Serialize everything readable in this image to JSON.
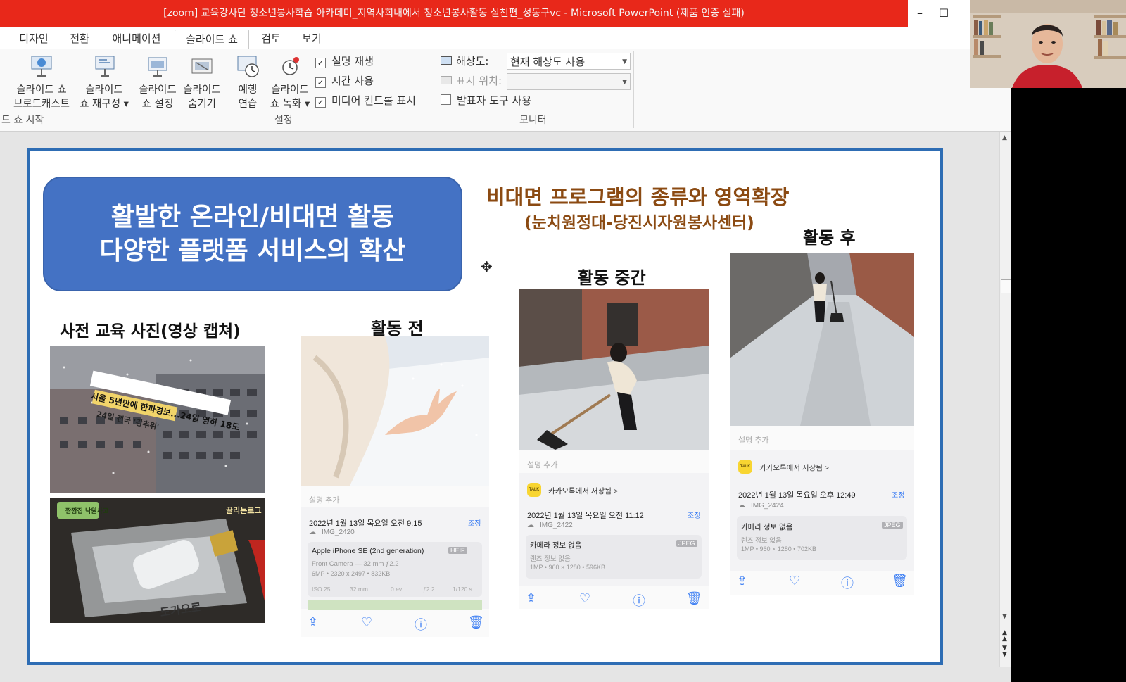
{
  "window": {
    "title": "[zoom] 교육강사단 청소년봉사학습 아카데미_지역사회내에서 청소년봉사활동 실천편_성동구vc  -  Microsoft PowerPoint (제품 인증 실패)",
    "minimize": "–",
    "maximize": "☐"
  },
  "tabs": [
    {
      "label": "디자인"
    },
    {
      "label": "전환"
    },
    {
      "label": "애니메이션"
    },
    {
      "label": "슬라이드 쇼"
    },
    {
      "label": "검토"
    },
    {
      "label": "보기"
    }
  ],
  "ribbon": {
    "broadcast": {
      "line1": "슬라이드 쇼",
      "line2": "브로드캐스트"
    },
    "reconfigure": {
      "line1": "슬라이드",
      "line2": "쇼 재구성"
    },
    "group_start": "드 쇼 시작",
    "setup": {
      "line1": "슬라이드",
      "line2": "쇼 설정"
    },
    "hide": {
      "line1": "슬라이드",
      "line2": "숨기기"
    },
    "rehearse": {
      "line1": "예행",
      "line2": "연습"
    },
    "record": {
      "line1": "슬라이드",
      "line2": "쇼 녹화"
    },
    "chk_narration": "설명 재생",
    "chk_timing": "시간 사용",
    "chk_media": "미디어 컨트롤 표시",
    "group_setup": "설정",
    "resolution_label": "해상도:",
    "resolution_value": "현재 해상도 사용",
    "show_on_label": "표시 위치:",
    "presenter_view": "발표자 도구 사용",
    "group_monitor": "모니터"
  },
  "slide": {
    "box_line1": "활발한 온라인/비대면 활동",
    "box_line2": "다양한 플랫폼 서비스의 확산",
    "heading1": "비대면 프로그램의 종류와 영역확장",
    "heading2": "(눈치원정대-당진시자원봉사센터)",
    "label_pre_edu": "사전 교육 사진(영상 캡쳐)",
    "label_before": "활동 전",
    "label_middle": "활동 중간",
    "label_after": "활동 후",
    "news_caption1": "서울 5년만에 한파경보...24일 영하 18도",
    "news_caption2": "24일 전국 '강추위'",
    "tv_logo": "끌리는로그",
    "tv_tag": "짬짬집 낙원사고",
    "box_text": "도가오로"
  },
  "photo_before": {
    "add_caption": "설명 추가",
    "date": "2022년 1월 13일 목요일 오전 9:15",
    "adjust": "조정",
    "file": "IMG_2420",
    "device": "Apple iPhone SE (2nd generation)",
    "format": "HEIF",
    "camera": "Front Camera — 32 mm ƒ2.2",
    "specs": "6MP • 2320 x 2497 • 832KB",
    "exif": [
      "ISO 25",
      "32 mm",
      "0 ev",
      "ƒ2.2",
      "1/120 s"
    ]
  },
  "photo_middle": {
    "add_caption": "설명 추가",
    "saved_from": "카카오톡에서 저장됨 >",
    "date": "2022년 1월 13일 목요일 오전 11:12",
    "adjust": "조정",
    "file": "IMG_2422",
    "camera_info": "카메라 정보 없음",
    "format": "JPEG",
    "lens_info": "렌즈 정보 없음",
    "specs": "1MP • 960 × 1280 • 596KB"
  },
  "photo_after": {
    "add_caption": "설명 추가",
    "saved_from": "카카오톡에서 저장됨 >",
    "date": "2022년 1월 13일 목요일 오후 12:49",
    "adjust": "조정",
    "file": "IMG_2424",
    "camera_info": "카메라 정보 없음",
    "format": "JPEG",
    "lens_info": "렌즈 정보 없음",
    "specs": "1MP • 960 × 1280 • 702KB"
  },
  "colors": {
    "titlebar": "#e8281a",
    "slide_border": "#2e6db4",
    "blue_box": "#4472c4",
    "heading": "#8b4a12",
    "ios_blue": "#3c7ef3"
  }
}
